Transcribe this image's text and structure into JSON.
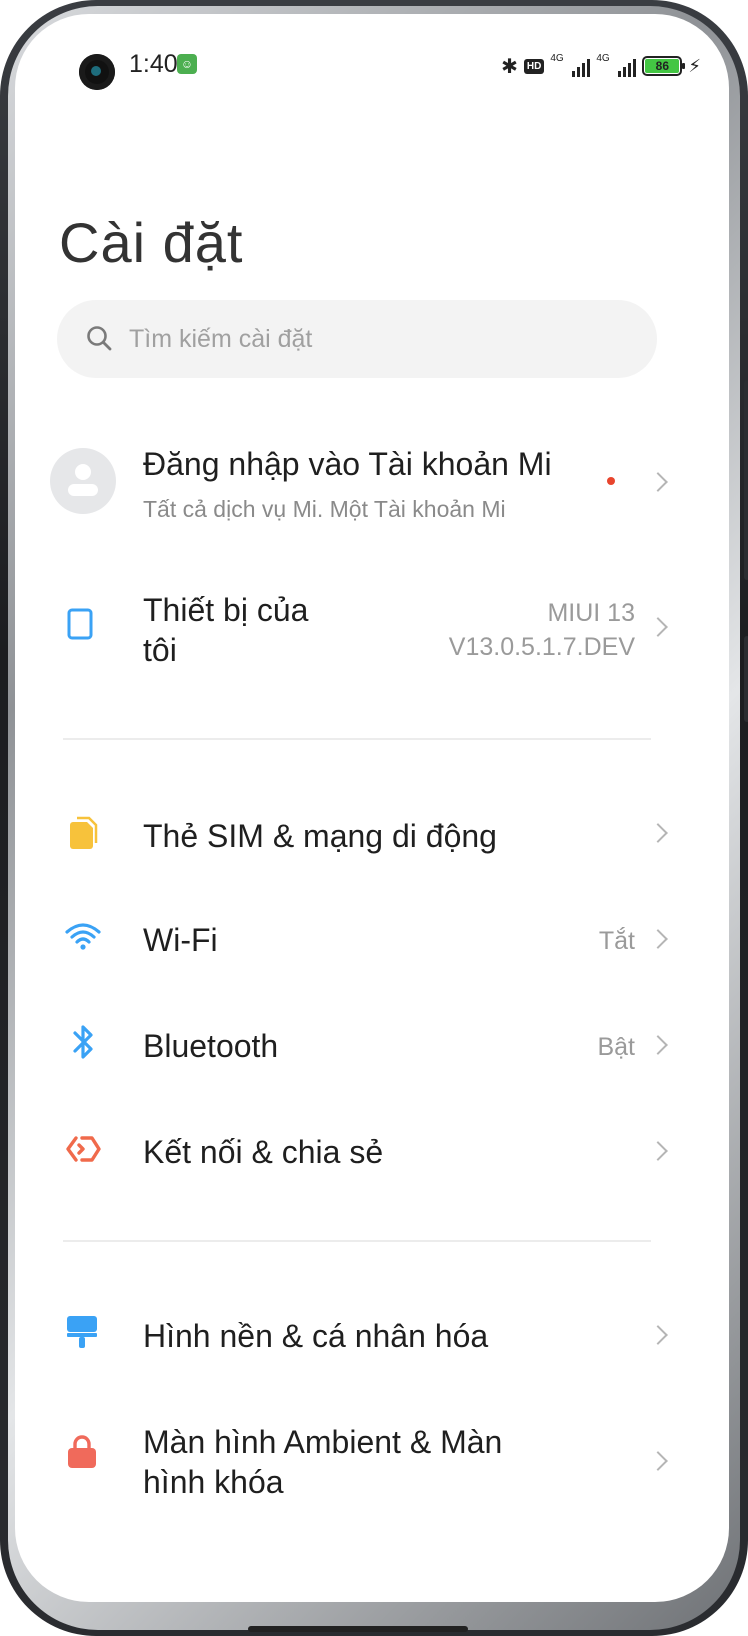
{
  "status_bar": {
    "time": "1:40",
    "signal1_label": "4G",
    "signal2_label": "4G",
    "hd_label": "HD",
    "battery_level": "86"
  },
  "header": {
    "title": "Cài đặt"
  },
  "search": {
    "placeholder": "Tìm kiếm cài đặt"
  },
  "account": {
    "title": "Đăng nhập vào Tài khoản Mi",
    "subtitle": "Tất cả dịch vụ Mi. Một Tài khoản Mi"
  },
  "device": {
    "title_line1": "Thiết bị của",
    "title_line2": "tôi",
    "value_line1": "MIUI 13",
    "value_line2": "V13.0.5.1.7.DEV"
  },
  "connectivity": [
    {
      "label": "Thẻ SIM & mạng di động",
      "value": "",
      "icon": "sim-card-icon",
      "color": "#f7c23b"
    },
    {
      "label": "Wi-Fi",
      "value": "Tắt",
      "icon": "wifi-icon",
      "color": "#3aa2f5"
    },
    {
      "label": "Bluetooth",
      "value": "Bật",
      "icon": "bluetooth-icon",
      "color": "#3aa2f5"
    },
    {
      "label": "Kết nối & chia sẻ",
      "value": "",
      "icon": "connection-sharing-icon",
      "color": "#f06a4b"
    }
  ],
  "personalization": [
    {
      "label": "Hình nền & cá nhân hóa",
      "icon": "wallpaper-icon",
      "color": "#3aa2f5"
    },
    {
      "label_line1": "Màn hình Ambient & Màn",
      "label_line2": "hình khóa",
      "icon": "lock-icon",
      "color": "#f06a5b"
    }
  ]
}
